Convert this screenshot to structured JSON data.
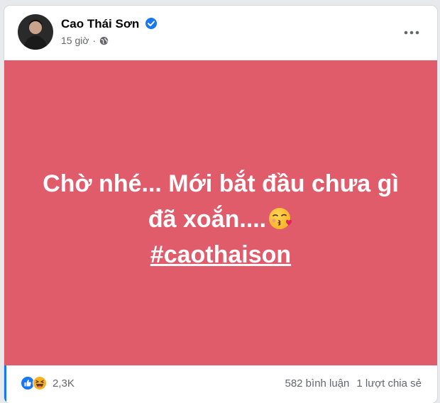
{
  "post": {
    "author": "Cao Thái Sơn",
    "verified_icon": "verified-badge-icon",
    "time": "15 giờ",
    "separator": "·",
    "privacy_icon": "globe-icon",
    "more_icon": "more-options-icon",
    "text_line1": "Chờ nhé... Mới bắt đầu chưa gì",
    "text_line2": "đã xoắn....",
    "emoji_icon": "face-blowing-kiss-icon",
    "hashtag": "#caothaison",
    "background_color": "#e05c6a"
  },
  "footer": {
    "reaction_icons": [
      "like-icon",
      "haha-icon"
    ],
    "reaction_count": "2,3K",
    "comments": "582 bình luận",
    "shares": "1 lượt chia sẻ"
  },
  "colors": {
    "accent": "#1877f2",
    "secondary_text": "#65676b"
  }
}
